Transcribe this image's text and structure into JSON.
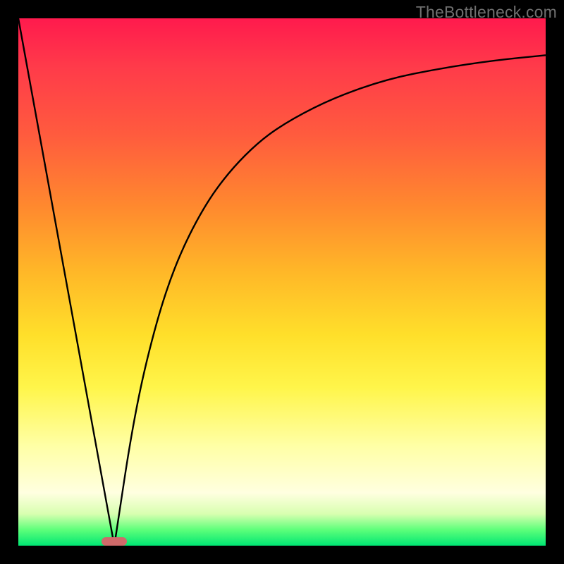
{
  "watermark": "TheBottleneck.com",
  "chart_data": {
    "type": "line",
    "title": "",
    "xlabel": "",
    "ylabel": "",
    "xlim": [
      0,
      100
    ],
    "ylim": [
      0,
      100
    ],
    "grid": false,
    "legend": false,
    "comment": "V-shaped bottleneck curve on a red→green vertical heat gradient. Left branch is a straight line from top-left down to the cusp; right branch rises as a saturating curve toward the top edge. A small pill-shaped marker sits at the cusp on the bottom axis.",
    "series": [
      {
        "name": "left-branch",
        "x": [
          0,
          18.2
        ],
        "y": [
          100,
          0
        ]
      },
      {
        "name": "right-branch",
        "x": [
          18.2,
          22,
          26,
          30,
          35,
          40,
          46,
          52,
          60,
          70,
          80,
          90,
          100
        ],
        "y": [
          0,
          25,
          42,
          54,
          64,
          71,
          77,
          81,
          85,
          88.5,
          90.5,
          92,
          93
        ]
      }
    ],
    "marker": {
      "x_center": 18.2,
      "width_pct": 4.8
    }
  },
  "colors": {
    "curve": "#000000",
    "marker": "#cf6a6a",
    "background_top": "#ff1a4d",
    "background_bottom": "#00e673"
  }
}
